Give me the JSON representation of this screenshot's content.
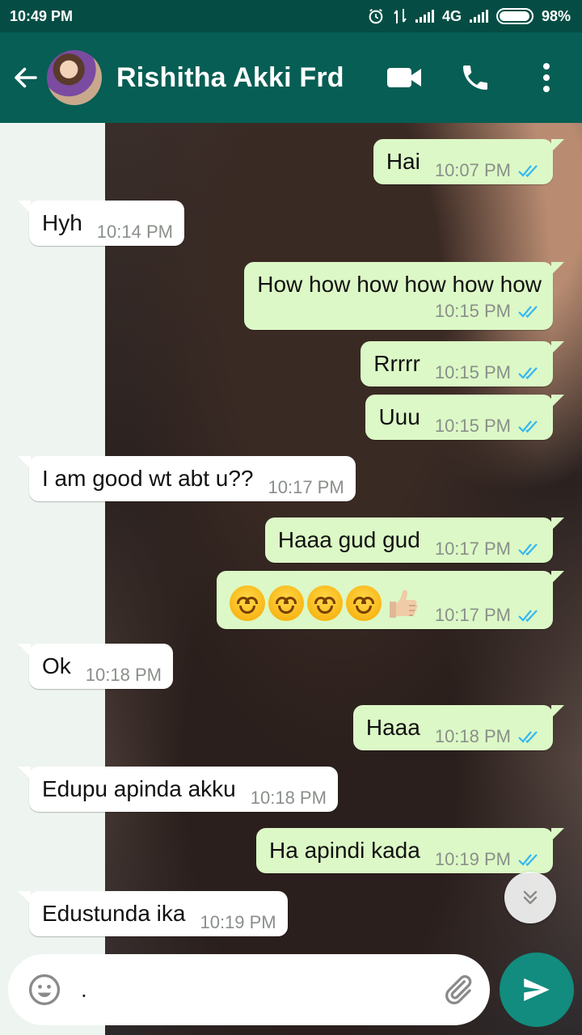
{
  "status": {
    "time": "10:49 PM",
    "network": "4G",
    "battery": "98%",
    "battery_level": 0.98
  },
  "header": {
    "contact_name": "Rishitha Akki Frd"
  },
  "messages": [
    {
      "dir": "out",
      "text": "Hai",
      "time": "10:07 PM"
    },
    {
      "dir": "in",
      "text": "Hyh",
      "time": "10:14 PM"
    },
    {
      "dir": "out",
      "text": "How how how  how how how",
      "time": "10:15 PM"
    },
    {
      "dir": "out",
      "text": "Rrrrr",
      "time": "10:15 PM"
    },
    {
      "dir": "out",
      "text": "Uuu",
      "time": "10:15 PM"
    },
    {
      "dir": "in",
      "text": "I am good wt abt u??",
      "time": "10:17 PM"
    },
    {
      "dir": "out",
      "text": "Haaa gud gud",
      "time": "10:17 PM"
    },
    {
      "dir": "out",
      "text": "😊😊😊😊👍",
      "time": "10:17 PM"
    },
    {
      "dir": "in",
      "text": "Ok",
      "time": "10:18 PM"
    },
    {
      "dir": "out",
      "text": "Haaa",
      "time": "10:18 PM"
    },
    {
      "dir": "in",
      "text": "Edupu apinda akku",
      "time": "10:18 PM"
    },
    {
      "dir": "out",
      "text": "Ha apindi  kada",
      "time": "10:19 PM"
    },
    {
      "dir": "in",
      "text": "Edustunda ika",
      "time": "10:19 PM"
    }
  ],
  "composer": {
    "value": "."
  },
  "colors": {
    "header": "#075e54",
    "statusbar": "#054d44",
    "outgoing_bubble": "#dcf8c6",
    "incoming_bubble": "#ffffff",
    "tick_read": "#34b7f1",
    "send_button": "#128c7e"
  }
}
